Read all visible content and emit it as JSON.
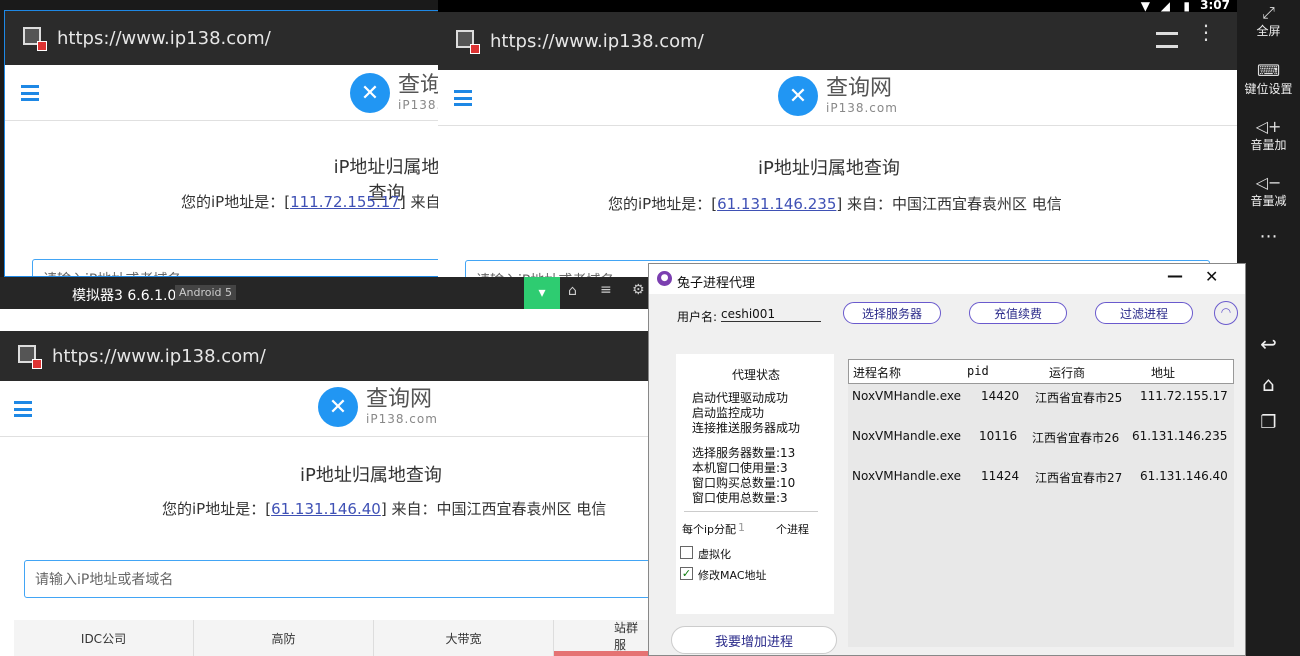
{
  "android_status": {
    "time": "3:07"
  },
  "android_bar": {
    "fullscreen": "全屏",
    "keymap": "键位设置",
    "vol_up": "音量加",
    "vol_down": "音量减",
    "more": "⋯"
  },
  "browser": {
    "url": "https://www.ip138.com/",
    "logo_title": "查询网",
    "logo_sub": "iP138.com",
    "page_heading": "iP地址归属地查询",
    "ip_prefix": "您的iP地址是：[",
    "ip_suffix_cut": "] 来自",
    "ip_suffix_full": "] 来自：中国江西宜春袁州区 电信",
    "search_placeholder": "请输入iP地址或者域名",
    "search_placeholder_cut": "请输入iP地址或者域名"
  },
  "emulators": [
    {
      "ip": "111.72.155.17"
    },
    {
      "ip": "61.131.146.235"
    },
    {
      "ip": "61.131.146.40"
    }
  ],
  "emu3": {
    "title": "模拟器3 6.6.1.0",
    "android_badge": "Android 5",
    "table_headers": [
      "IDC公司",
      "高防",
      "大带宽",
      "站群服"
    ]
  },
  "proxy": {
    "title": "兔子进程代理",
    "username_label": "用户名:",
    "username_value": "ceshi001",
    "btn_select_server": "选择服务器",
    "btn_recharge": "充值续费",
    "btn_filter": "过滤进程",
    "status_title": "代理状态",
    "status_lines": [
      "启动代理驱动成功",
      "启动监控成功",
      "连接推送服务器成功"
    ],
    "stats_lines": [
      "选择服务器数量:13",
      "本机窗口使用量:3",
      "窗口购买总数量:10",
      "窗口使用总数量:3"
    ],
    "per_ip_label": "每个ip分配",
    "per_ip_value": "1",
    "per_ip_unit": "个进程",
    "virtualize_label": "虚拟化",
    "virtualize_checked": false,
    "mac_label": "修改MAC地址",
    "mac_checked": true,
    "add_process": "我要增加进程",
    "columns": [
      "进程名称",
      "pid",
      "运行商",
      "地址"
    ],
    "rows": [
      {
        "name": "NoxVMHandle.exe",
        "pid": "14420",
        "isp": "江西省宜春市25",
        "addr": "111.72.155.17"
      },
      {
        "name": "NoxVMHandle.exe",
        "pid": "10116",
        "isp": "江西省宜春市26",
        "addr": "61.131.146.235"
      },
      {
        "name": "NoxVMHandle.exe",
        "pid": "11424",
        "isp": "江西省宜春市27",
        "addr": "61.131.146.40"
      }
    ],
    "minimize": "—",
    "close": "✕"
  }
}
